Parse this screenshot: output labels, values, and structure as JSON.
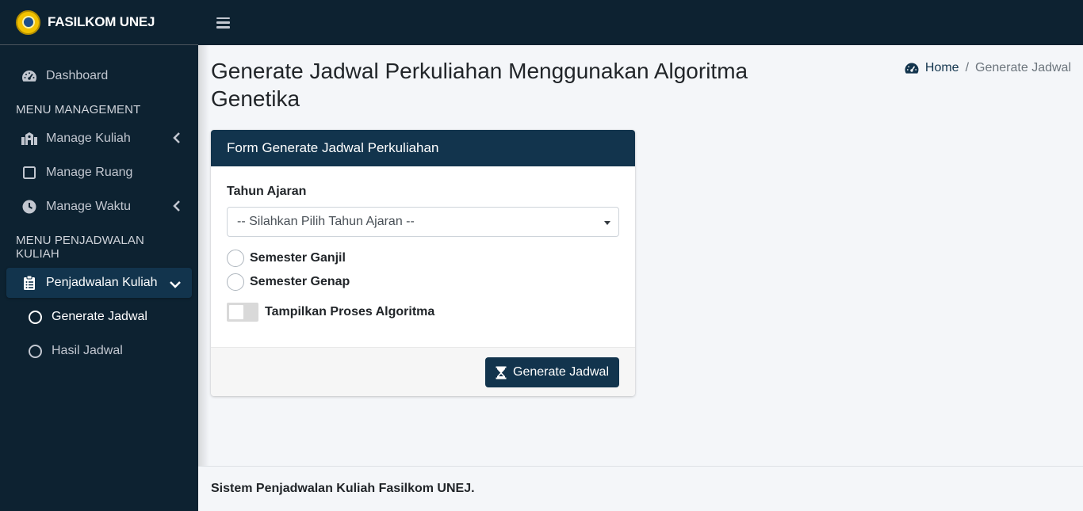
{
  "brand": {
    "name": "FASILKOM UNEJ"
  },
  "sidebar": {
    "dashboard": "Dashboard",
    "menu_management_header": "MENU MANAGEMENT",
    "manage_kuliah": "Manage Kuliah",
    "manage_ruang": "Manage Ruang",
    "manage_waktu": "Manage Waktu",
    "menu_penjadwalan_header": "MENU PENJADWALAN KULIAH",
    "penjadwalan_kuliah": "Penjadwalan Kuliah",
    "generate_jadwal": "Generate Jadwal",
    "hasil_jadwal": "Hasil Jadwal"
  },
  "page": {
    "title": "Generate Jadwal Perkuliahan Menggunakan Algoritma Genetika"
  },
  "breadcrumb": {
    "home": "Home",
    "separator": "/",
    "current": "Generate Jadwal"
  },
  "form": {
    "header": "Form Generate Jadwal Perkuliahan",
    "tahun_label": "Tahun Ajaran",
    "tahun_placeholder": "-- Silahkan Pilih Tahun Ajaran --",
    "semester_ganjil": "Semester Ganjil",
    "semester_genap": "Semester Genap",
    "toggle_label": "Tampilkan Proses Algoritma",
    "submit_label": "Generate Jadwal"
  },
  "footer": {
    "text": "Sistem Penjadwalan Kuliah Fasilkom UNEJ."
  },
  "colors": {
    "sidebar_bg": "#0d2231",
    "accent": "#12344d",
    "content_bg": "#f4f6f9"
  }
}
